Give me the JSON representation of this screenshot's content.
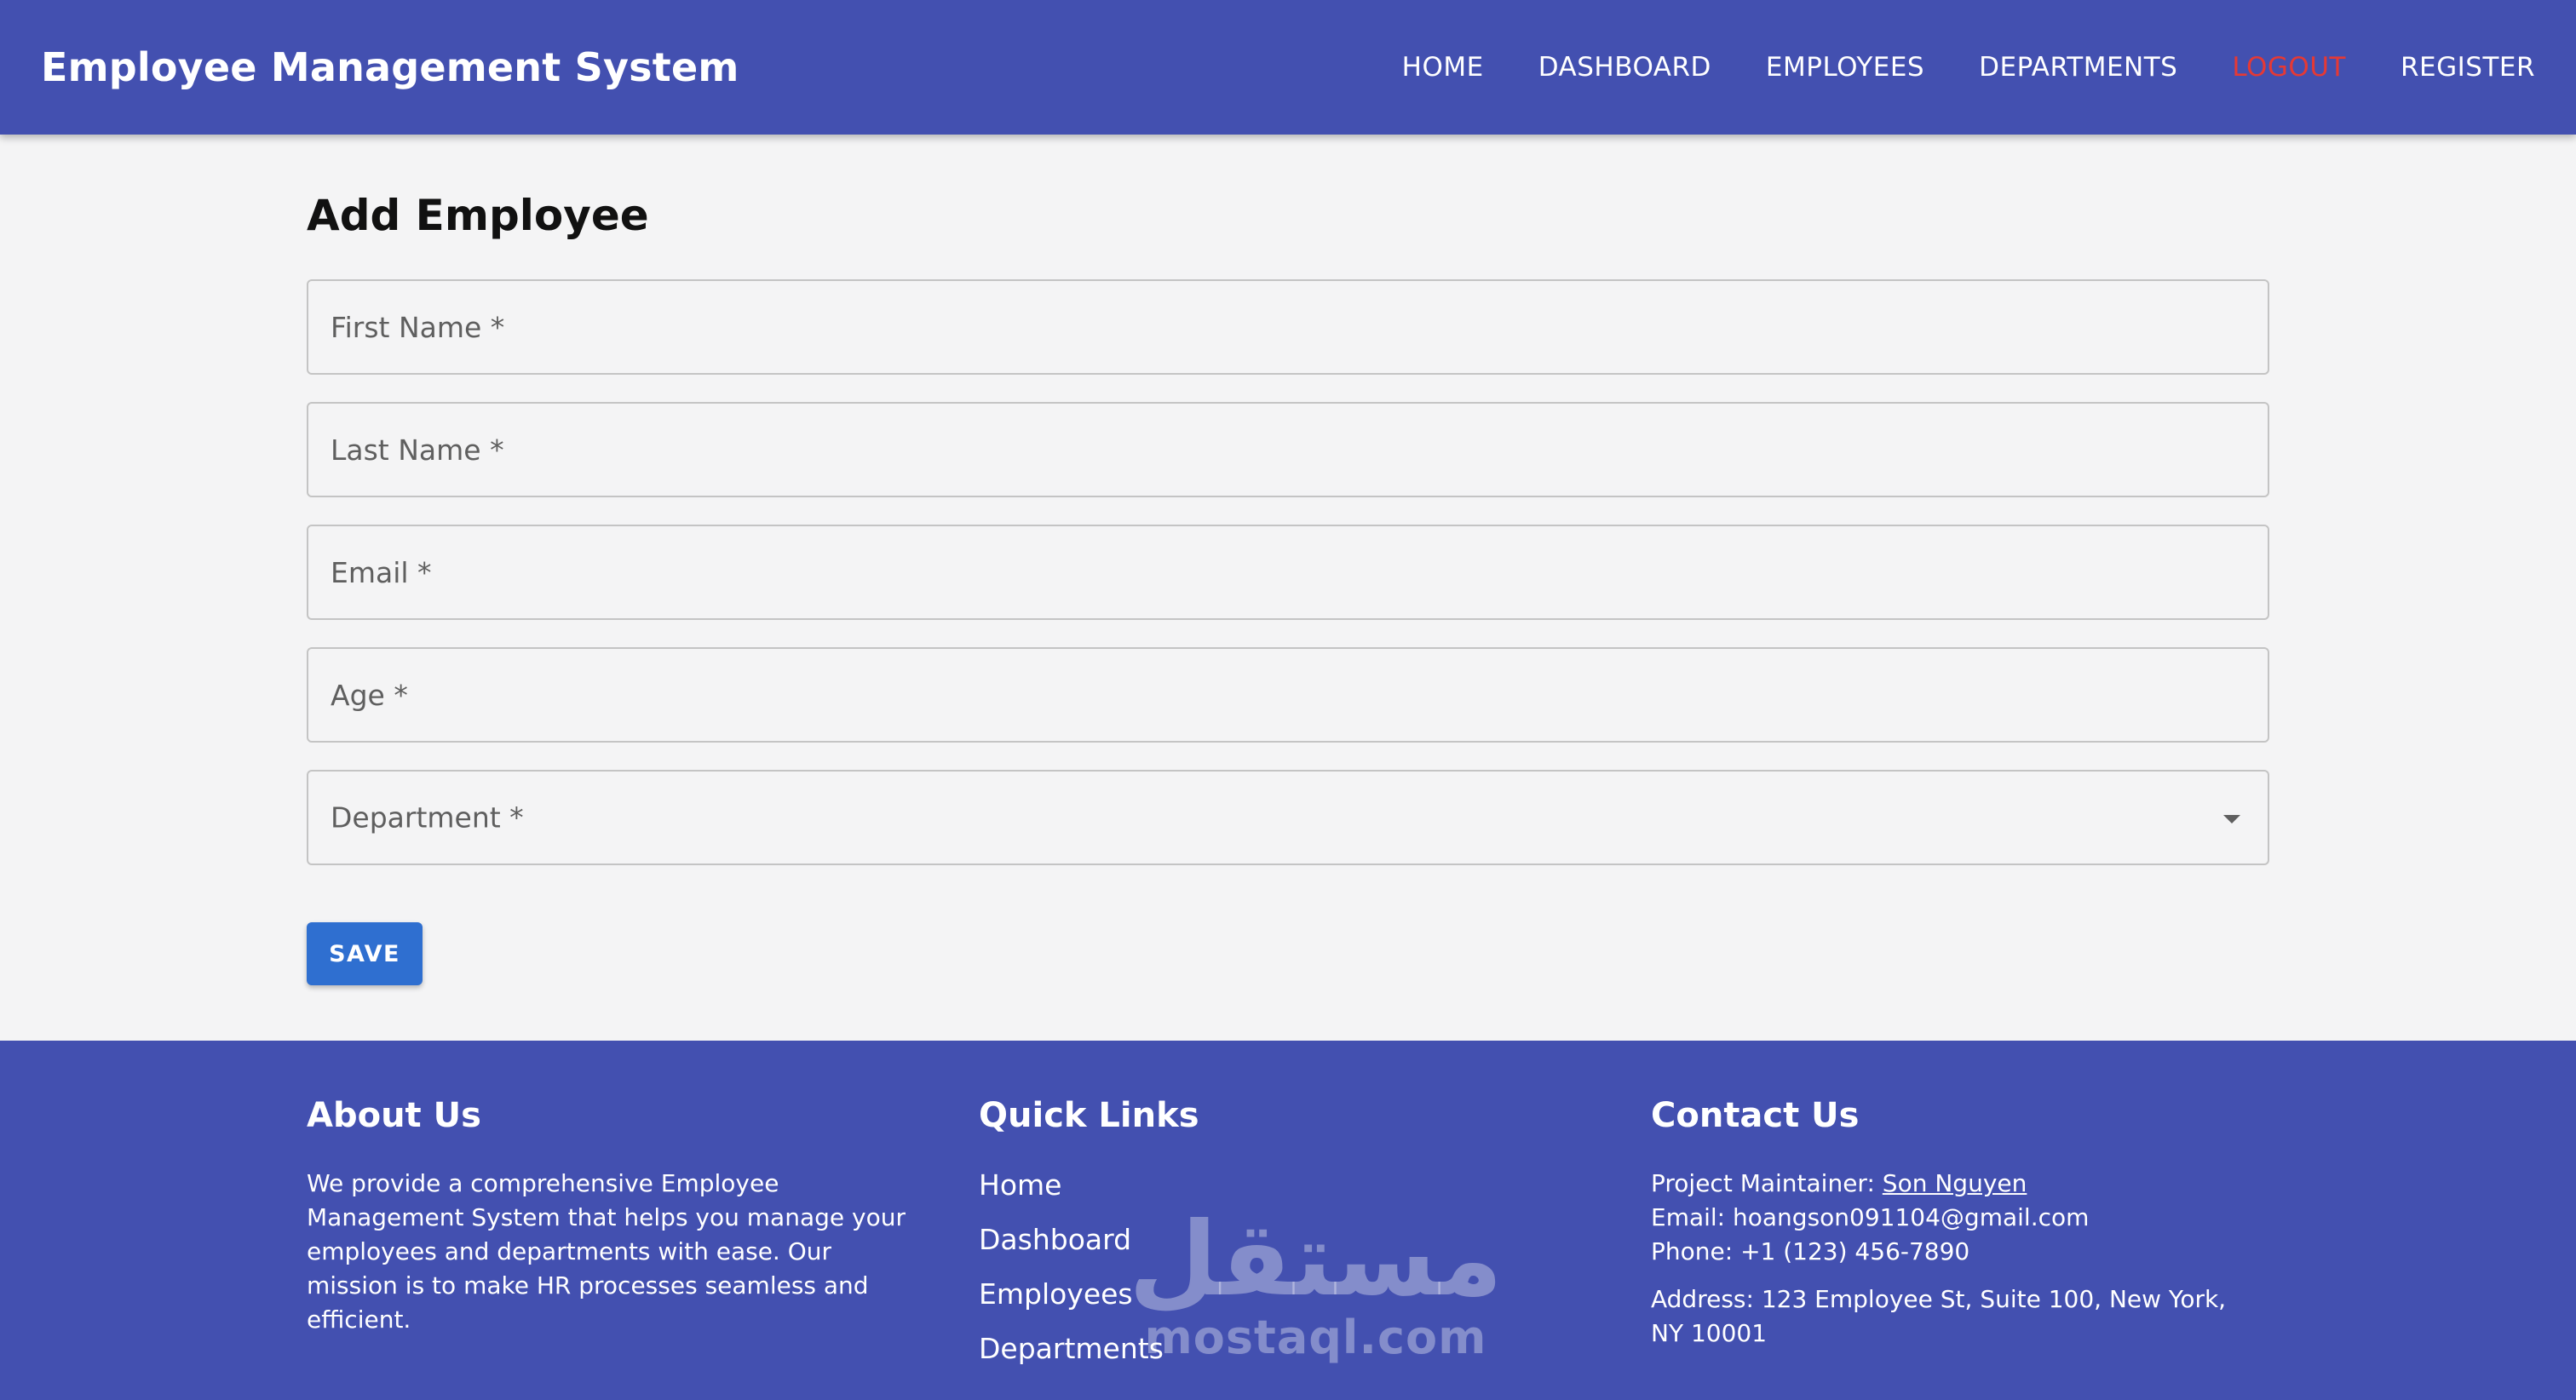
{
  "header": {
    "title": "Employee Management System",
    "nav": {
      "home": "HOME",
      "dashboard": "DASHBOARD",
      "employees": "EMPLOYEES",
      "departments": "DEPARTMENTS",
      "logout": "LOGOUT",
      "register": "REGISTER"
    }
  },
  "main": {
    "title": "Add Employee",
    "form": {
      "first_name": {
        "label": "First Name *",
        "value": ""
      },
      "last_name": {
        "label": "Last Name *",
        "value": ""
      },
      "email": {
        "label": "Email *",
        "value": ""
      },
      "age": {
        "label": "Age *",
        "value": ""
      },
      "department": {
        "label": "Department *",
        "value": ""
      }
    },
    "save_label": "SAVE"
  },
  "footer": {
    "about": {
      "title": "About Us",
      "text": "We provide a comprehensive Employee Management System that helps you manage your employees and departments with ease. Our mission is to make HR processes seamless and efficient."
    },
    "quick_links": {
      "title": "Quick Links",
      "items": [
        "Home",
        "Dashboard",
        "Employees",
        "Departments"
      ]
    },
    "contact": {
      "title": "Contact Us",
      "maintainer_label": "Project Maintainer: ",
      "maintainer_name": "Son Nguyen",
      "email_line": "Email: hoangson091104@gmail.com",
      "phone_line": "Phone: +1 (123) 456-7890",
      "address_line": "Address: 123 Employee St, Suite 100, New York, NY 10001"
    }
  },
  "watermark": {
    "arabic": "مستقل",
    "latin": "mostaql.com"
  },
  "colors": {
    "primary": "#4350b0",
    "logout": "#e53935",
    "save_button": "#2f6fd0",
    "background": "#f4f4f5"
  }
}
